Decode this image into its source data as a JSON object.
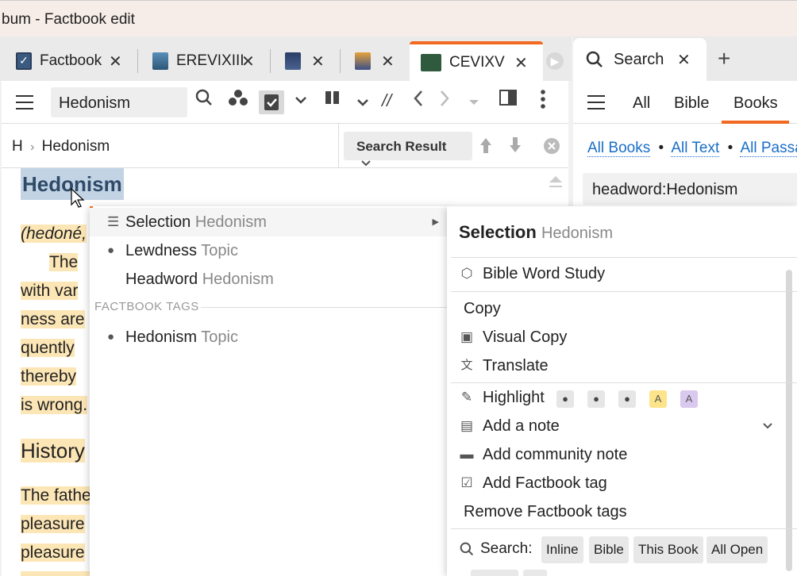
{
  "window": {
    "title": "bum - Factbook edit"
  },
  "tabs": [
    {
      "label": "Factbook"
    },
    {
      "label": "EREVIXIII"
    },
    {
      "label": ""
    },
    {
      "label": ""
    },
    {
      "label": "CEVIXV"
    }
  ],
  "toolbar": {
    "reference": "Hedonism"
  },
  "breadcrumb": {
    "root": "H",
    "separator": "›",
    "current": "Hedonism",
    "search_result": "Search Result"
  },
  "content": {
    "heading": "Hedonism",
    "lines": [
      "(hedoné,",
      "The",
      "with var",
      "ness are",
      "quently",
      "thereby",
      "is wrong."
    ],
    "section_heading": "History",
    "lines2": [
      "The fathe",
      "pleasure",
      "pleasure"
    ]
  },
  "context_menu": {
    "items": [
      {
        "label": "Selection",
        "sub": "Hedonism",
        "icon": "lines-icon"
      },
      {
        "label": "Lewdness",
        "sub": "Topic",
        "icon": "speech-bubble-icon"
      },
      {
        "label": "Headword",
        "sub": "Hedonism",
        "icon": ""
      }
    ],
    "section": "FACTBOOK TAGS",
    "tag_items": [
      {
        "label": "Hedonism",
        "sub": "Topic",
        "icon": "speech-bubble-icon"
      }
    ]
  },
  "submenu": {
    "title": "Selection",
    "title_sub": "Hedonism",
    "items": [
      {
        "label": "Bible Word Study"
      },
      {
        "label": "Copy"
      },
      {
        "label": "Visual Copy"
      },
      {
        "label": "Translate"
      },
      {
        "label": "Highlight"
      },
      {
        "label": "Add a note"
      },
      {
        "label": "Add community note"
      },
      {
        "label": "Add Factbook tag"
      },
      {
        "label": "Remove Factbook tags"
      }
    ],
    "highlight_styles": [
      "",
      "",
      "",
      "A",
      "A"
    ],
    "search_label": "Search:",
    "search_chips": [
      "Inline",
      "Bible",
      "This Book",
      "All Open"
    ]
  },
  "search_panel": {
    "tab_label": "Search",
    "scopes": [
      "All",
      "Bible",
      "Books"
    ],
    "links": [
      "All Books",
      "All Text",
      "All Passa"
    ],
    "link_sep": "•",
    "query": "headword:Hedonism"
  },
  "colors": {
    "accent": "#f26a22",
    "highlight": "#fde6b6",
    "selection": "#c2d3e4",
    "link": "#1a6ec8"
  }
}
